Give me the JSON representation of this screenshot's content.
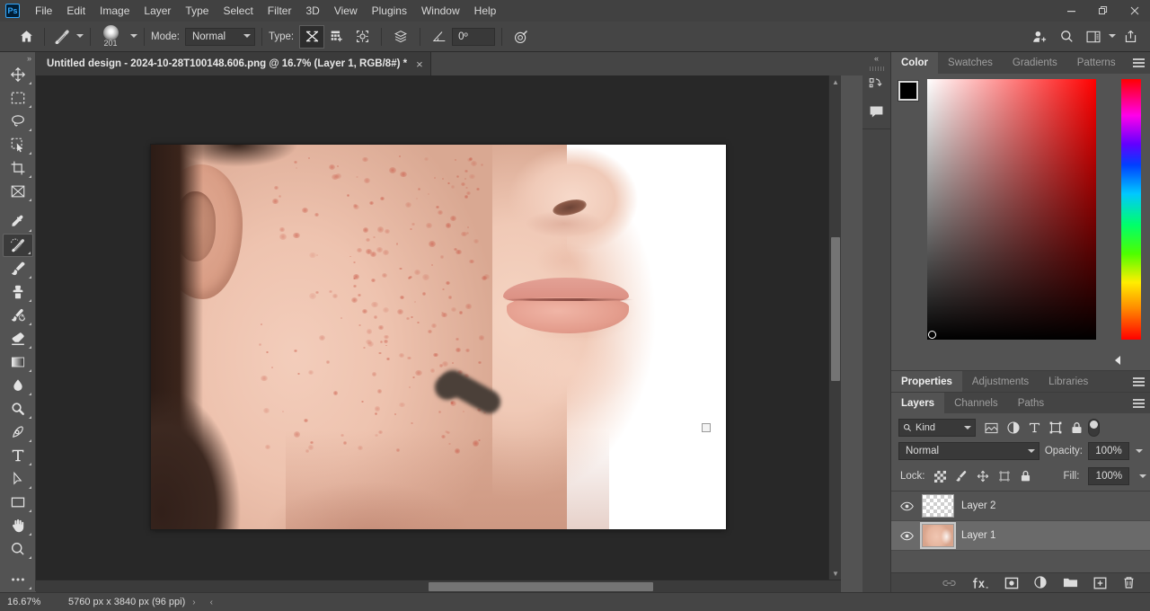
{
  "app": {
    "name": "Adobe Photoshop",
    "logo_text": "Ps"
  },
  "menubar": {
    "items": [
      "File",
      "Edit",
      "Image",
      "Layer",
      "Type",
      "Select",
      "Filter",
      "3D",
      "View",
      "Plugins",
      "Window",
      "Help"
    ],
    "window_controls": [
      "minimize",
      "restore",
      "close"
    ]
  },
  "options_bar": {
    "home_icon": "home-icon",
    "tool_icon": "healing-brush-icon",
    "brush_size": "201",
    "mode_label": "Mode:",
    "mode_value": "Normal",
    "type_label": "Type:",
    "type_buttons": [
      "content-aware",
      "create-texture",
      "proximity-match"
    ],
    "sample_all_layers_icon": "sample-all-layers-icon",
    "angle_icon": "angle-icon",
    "angle_value": "0º",
    "pressure_icon": "pressure-for-size-icon",
    "right_icons": [
      "share-user-icon",
      "search-icon",
      "workspace-icon",
      "chevron-down-icon",
      "share-export-icon"
    ]
  },
  "toolbar": {
    "tools": [
      {
        "name": "move-tool",
        "selected": false
      },
      {
        "name": "rectangular-marquee-tool",
        "selected": false
      },
      {
        "name": "lasso-tool",
        "selected": false
      },
      {
        "name": "object-selection-tool",
        "selected": false
      },
      {
        "name": "crop-tool",
        "selected": false
      },
      {
        "name": "frame-tool",
        "selected": false
      },
      {
        "name": "eyedropper-tool",
        "selected": false
      },
      {
        "name": "spot-healing-brush-tool",
        "selected": true
      },
      {
        "name": "brush-tool",
        "selected": false
      },
      {
        "name": "clone-stamp-tool",
        "selected": false
      },
      {
        "name": "history-brush-tool",
        "selected": false
      },
      {
        "name": "eraser-tool",
        "selected": false
      },
      {
        "name": "gradient-tool",
        "selected": false
      },
      {
        "name": "blur-tool",
        "selected": false
      },
      {
        "name": "dodge-tool",
        "selected": false
      },
      {
        "name": "pen-tool",
        "selected": false
      },
      {
        "name": "type-tool",
        "selected": false
      },
      {
        "name": "path-selection-tool",
        "selected": false
      },
      {
        "name": "rectangle-tool",
        "selected": false
      },
      {
        "name": "hand-tool",
        "selected": false
      },
      {
        "name": "zoom-tool",
        "selected": false
      },
      {
        "name": "edit-toolbar-tool",
        "selected": false
      }
    ]
  },
  "document": {
    "tab_title": "Untitled design - 2024-10-28T100148.606.png @ 16.7% (Layer 1, RGB/8#) *",
    "close_label": "×"
  },
  "canvas": {
    "image_description": "Close-up photograph of a young person's cheek and jaw with red acne lesions; a dark grey brush stroke has been painted over a blemish area near the chin.",
    "background_color": "#282828",
    "artboard_color": "#ffffff"
  },
  "status_bar": {
    "zoom": "16.67%",
    "doc_info": "5760 px x 3840 px (96 ppi)",
    "chevron_right": "›",
    "chevron_left": "‹"
  },
  "dock_rail": {
    "collapse_icon": "double-chevron-left-icon",
    "buttons": [
      "libraries-icon",
      "comments-icon"
    ]
  },
  "color_panel": {
    "tabs": [
      {
        "label": "Color",
        "active": true
      },
      {
        "label": "Swatches",
        "active": false
      },
      {
        "label": "Gradients",
        "active": false
      },
      {
        "label": "Patterns",
        "active": false
      }
    ],
    "menu_icon": "panel-menu-icon",
    "foreground_color": "#000000",
    "background_color": "#ffffff",
    "field_hue": "#ff0000"
  },
  "properties_panel": {
    "tabs": [
      {
        "label": "Properties",
        "active": true
      },
      {
        "label": "Adjustments",
        "active": false
      },
      {
        "label": "Libraries",
        "active": false
      }
    ],
    "menu_icon": "panel-menu-icon"
  },
  "layers_panel": {
    "tabs": [
      {
        "label": "Layers",
        "active": true
      },
      {
        "label": "Channels",
        "active": false
      },
      {
        "label": "Paths",
        "active": false
      }
    ],
    "menu_icon": "panel-menu-icon",
    "filter": {
      "search_icon": "search-icon",
      "kind_label": "Kind",
      "icons": [
        "filter-pixel-icon",
        "filter-adjustment-icon",
        "filter-type-icon",
        "filter-shape-icon",
        "filter-smart-object-icon"
      ],
      "toggle_name": "filter-toggle"
    },
    "blend_mode": "Normal",
    "opacity_label": "Opacity:",
    "opacity_value": "100%",
    "lock_label": "Lock:",
    "lock_icons": [
      "lock-transparent-pixels-icon",
      "lock-image-pixels-icon",
      "lock-position-icon",
      "lock-artboard-nesting-icon",
      "lock-all-icon"
    ],
    "fill_label": "Fill:",
    "fill_value": "100%",
    "layers": [
      {
        "name": "Layer 2",
        "visible": true,
        "selected": false,
        "thumb": "transparent"
      },
      {
        "name": "Layer 1",
        "visible": true,
        "selected": true,
        "thumb": "face-photo"
      }
    ],
    "footer_icons": [
      "link-layers-icon",
      "layer-style-fx-icon",
      "add-layer-mask-icon",
      "new-fill-adjustment-icon",
      "new-group-icon",
      "new-layer-icon",
      "delete-layer-icon"
    ]
  },
  "colors": {
    "chrome": "#535353",
    "panel_header": "#444444",
    "canvas_bg": "#282828",
    "accent_blue": "#31a8ff",
    "text": "#d4d4d4"
  }
}
